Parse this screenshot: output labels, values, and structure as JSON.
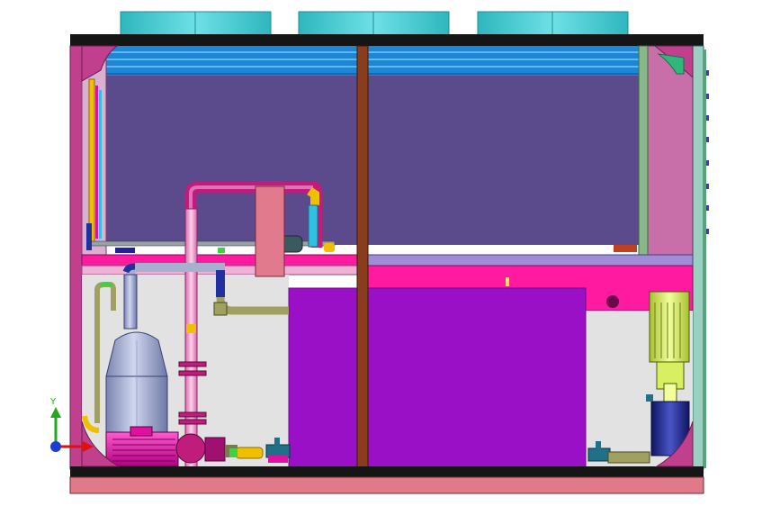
{
  "view": {
    "background": "#ffffff",
    "triad": {
      "x_label": "",
      "y_label": "Y",
      "x_color": "#e01010",
      "y_color": "#1faa1f",
      "origin_color": "#1a3fd0"
    }
  },
  "colors": {
    "fan": "#3cc4cc",
    "fan_edge": "#1f8d93",
    "frame_dark": "#151515",
    "skirt": "#e07a88",
    "side_post": "#c0408e",
    "panel_violet": "#5b4a8c",
    "coil_blue": "#1e86d6",
    "coil_stripe": "#5fb8f0",
    "lower_bg": "#e2e2e2",
    "shelf_pink": "#ff1aa0",
    "beam_light": "#f0b0d8",
    "center_post": "#8a3d1c",
    "right_panel": "#c86ea8",
    "tank_purple": "#9a10c6",
    "tank_edge": "#6a0a8a",
    "motor_mag": "#e010a0",
    "pump_steel": "#a8b0d0",
    "pump_motor_yellow": "#d8f060",
    "pump_dark_blue": "#1a2080",
    "pipe_pink": "#f08ac8",
    "pipe_magenta": "#c01c7c",
    "pipe_yellow": "#f0c000",
    "pipe_cyan": "#30c0e0",
    "pipe_olive": "#a0a060",
    "pipe_green": "#40d040",
    "pipe_navy": "#2030a0",
    "valve_teal": "#207088",
    "hx_salmon": "#e07a8c"
  },
  "components": [
    {
      "name": "condenser-fan",
      "count": 3
    },
    {
      "name": "condenser-coil"
    },
    {
      "name": "compressor"
    },
    {
      "name": "water-tank"
    },
    {
      "name": "circulation-pump"
    },
    {
      "name": "plate-heat-exchanger"
    },
    {
      "name": "ball-valve",
      "count": 2
    },
    {
      "name": "electric-motor"
    }
  ]
}
